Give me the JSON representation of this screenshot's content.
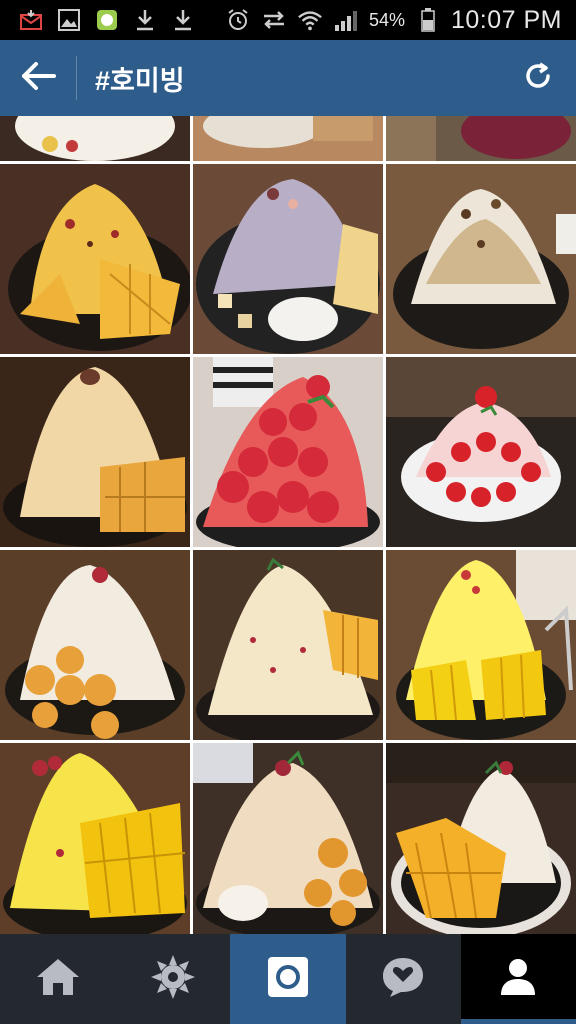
{
  "status_bar": {
    "battery_percent": "54%",
    "time": "10:07 PM",
    "icons": [
      "email-download-icon",
      "gallery-icon",
      "app-notification-icon",
      "download-icon",
      "download-icon",
      "alarm-icon",
      "data-sync-icon",
      "wifi-icon",
      "signal-icon",
      "battery-icon"
    ]
  },
  "app_bar": {
    "title": "#호미빙",
    "back_icon": "arrow-left-icon",
    "refresh_icon": "refresh-icon"
  },
  "grid": {
    "description_items": [
      "shaved ice partial top-left",
      "shaved ice partial top-center",
      "shaved ice partial top-right",
      "mango bingsu",
      "taro bingsu",
      "injeolmi bingsu",
      "mango snow bingsu",
      "strawberry bingsu",
      "strawberry snow bingsu",
      "choux cream bingsu",
      "mango cream bingsu",
      "mango cheese bingsu",
      "mango bingsu",
      "choux cream bingsu",
      "mango cream bingsu"
    ]
  },
  "bottom_nav": {
    "items": [
      "home-icon",
      "explore-icon",
      "camera-icon",
      "activity-icon",
      "profile-icon"
    ],
    "active": "camera-icon"
  },
  "colors": {
    "accent": "#2f5d8b",
    "nav_bg": "#24292f",
    "status_bg": "#000000"
  }
}
